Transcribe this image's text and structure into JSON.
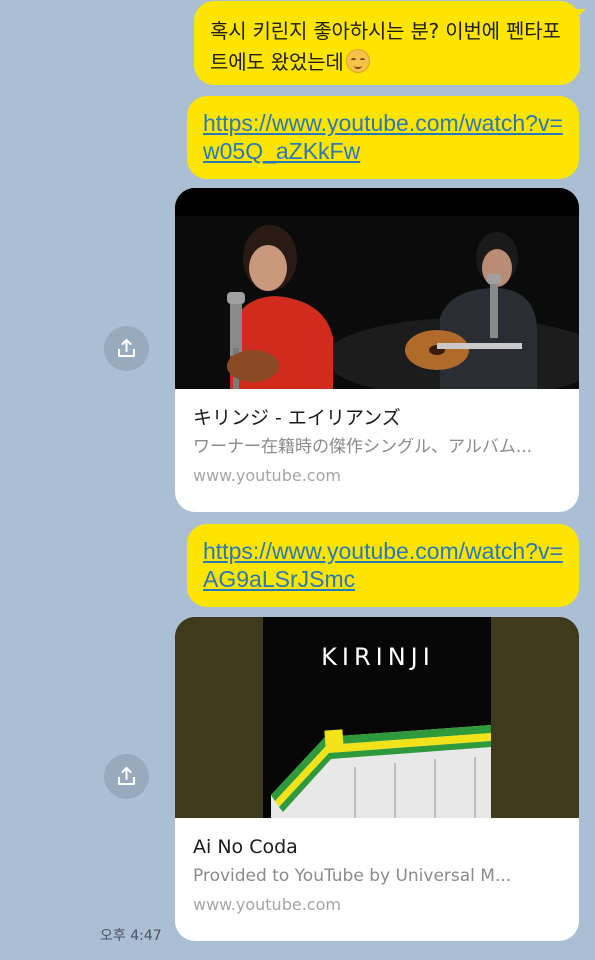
{
  "messages": {
    "text": "혹시 키린지 좋아하시는 분? 이번에 펜타포트에도 왔었는데",
    "text_emoji": "smiling-face-emoji",
    "link1": "https://www.youtube.com/watch?v=w05Q_aZKkFw",
    "link2": "https://www.youtube.com/watch?v=AG9aLSrJSmc"
  },
  "cards": [
    {
      "title": "キリンジ - エイリアンズ",
      "description": "ワーナー在籍時の傑作シングル、アルバム...",
      "domain": "www.youtube.com"
    },
    {
      "title": "Ai No Coda",
      "description": "Provided to YouTube by Universal M...",
      "domain": "www.youtube.com",
      "thumb_logo": "KIRINJI"
    }
  ],
  "share_icon": "share-icon",
  "timestamp": "오후 4:47",
  "colors": {
    "background": "#abbfd4",
    "bubble": "#fee500",
    "link": "#2a78b8"
  }
}
